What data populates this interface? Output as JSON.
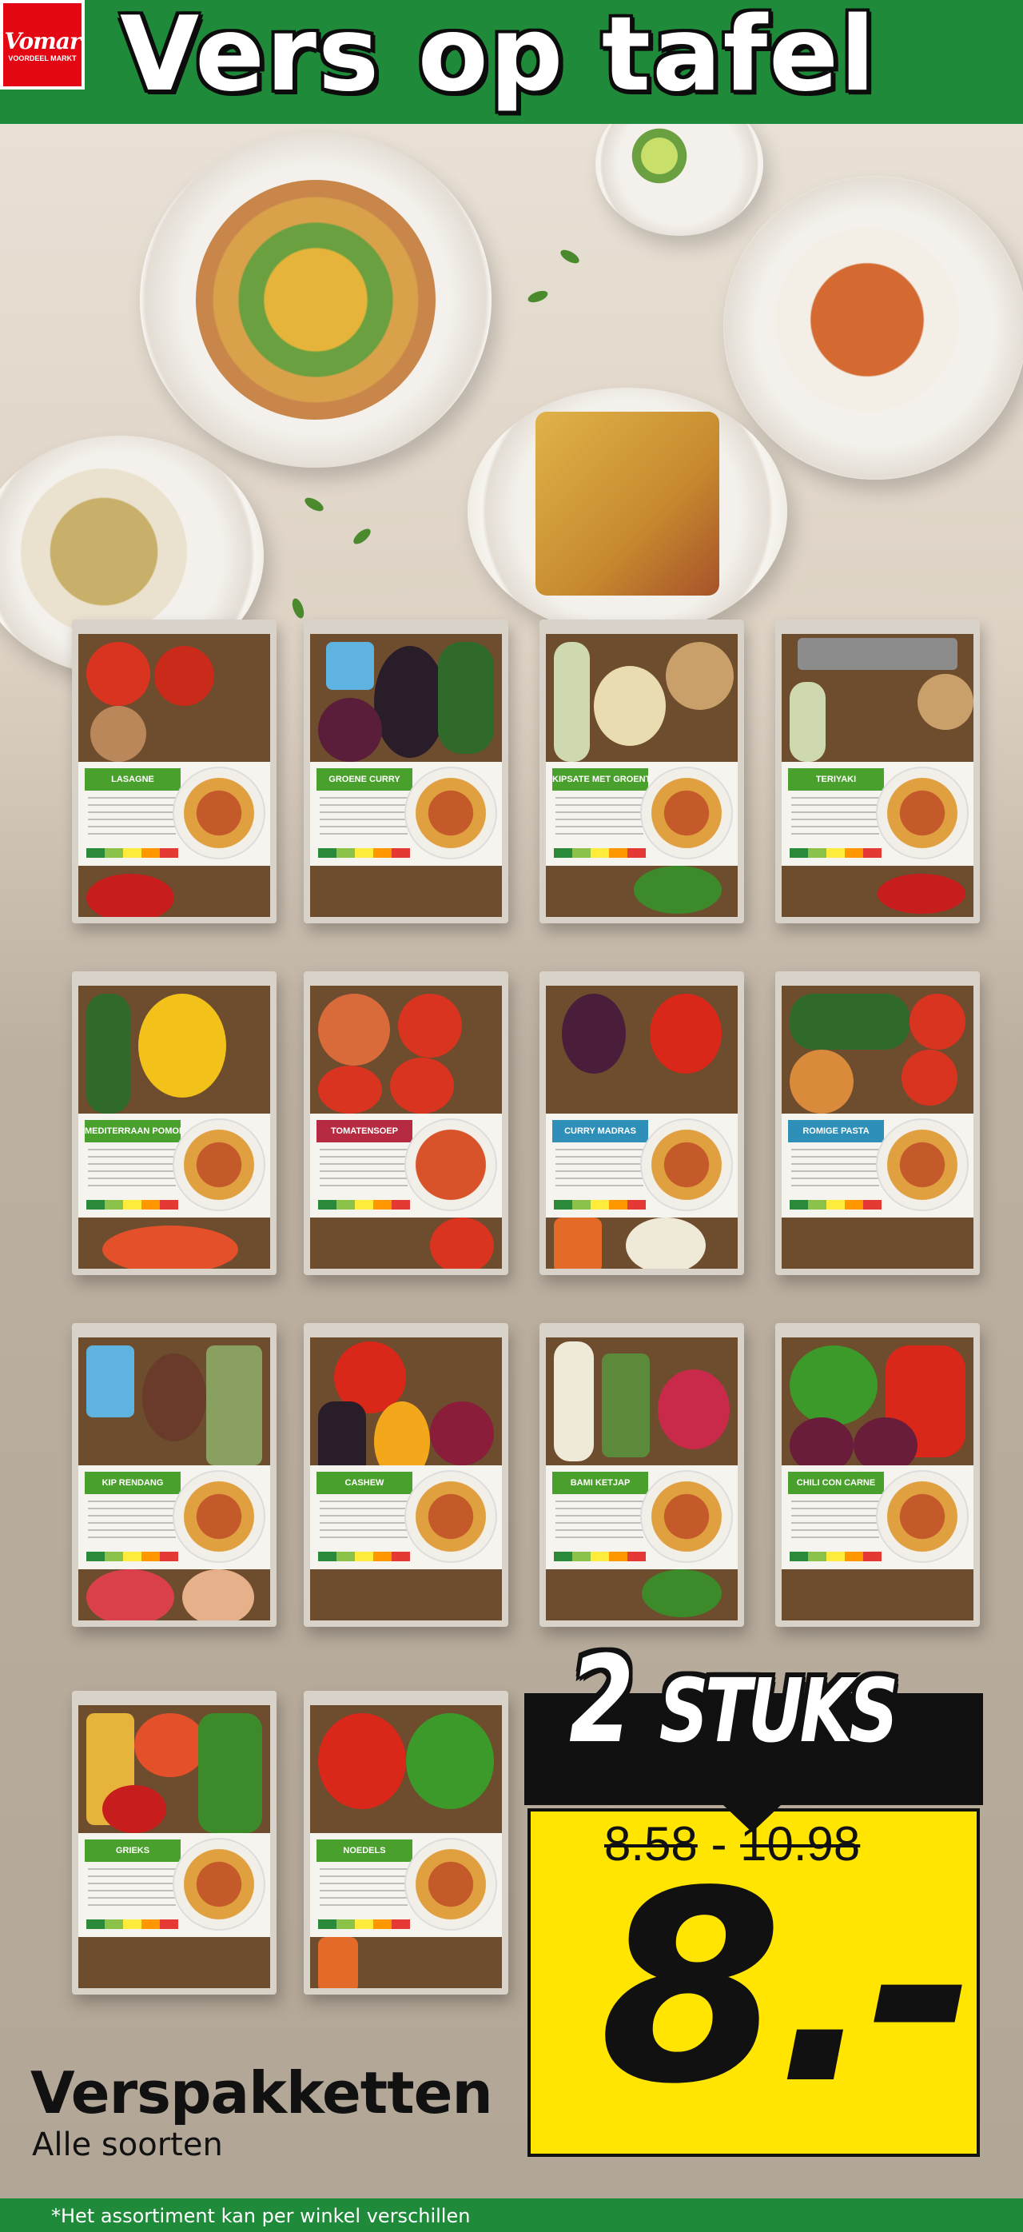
{
  "brand": {
    "logo_text": "Vomar",
    "logo_subtext": "VOORDEEL MARKT",
    "color": "#e30613",
    "header_green": "#1f8a3a"
  },
  "headline": "Vers op tafel",
  "packages": [
    {
      "label": "LASAGNE"
    },
    {
      "label": "GROENE CURRY"
    },
    {
      "label": "KIPSATE MET GROENTEN"
    },
    {
      "label": "TERIYAKI"
    },
    {
      "label": "MEDITERRAAN POMODORI"
    },
    {
      "label": "TOMATENSOEP"
    },
    {
      "label": "CURRY MADRAS"
    },
    {
      "label": "ROMIGE PASTA"
    },
    {
      "label": "KIP RENDANG"
    },
    {
      "label": "CASHEW"
    },
    {
      "label": "BAMI KETJAP"
    },
    {
      "label": "CHILI CON CARNE"
    },
    {
      "label": "GRIEKS"
    },
    {
      "label": "NOEDELS"
    }
  ],
  "offer": {
    "quantity": "2 STUKS",
    "quantity_number": "2",
    "quantity_unit": "STUKS",
    "old_price_low": "8.58",
    "separator": "-",
    "old_price_high": "10.98",
    "price": "8.-",
    "highlight_color": "#ffe500"
  },
  "product": {
    "name": "Verspakketten",
    "subtitle": "Alle soorten"
  },
  "footnote": "*Het assortiment kan per winkel verschillen"
}
